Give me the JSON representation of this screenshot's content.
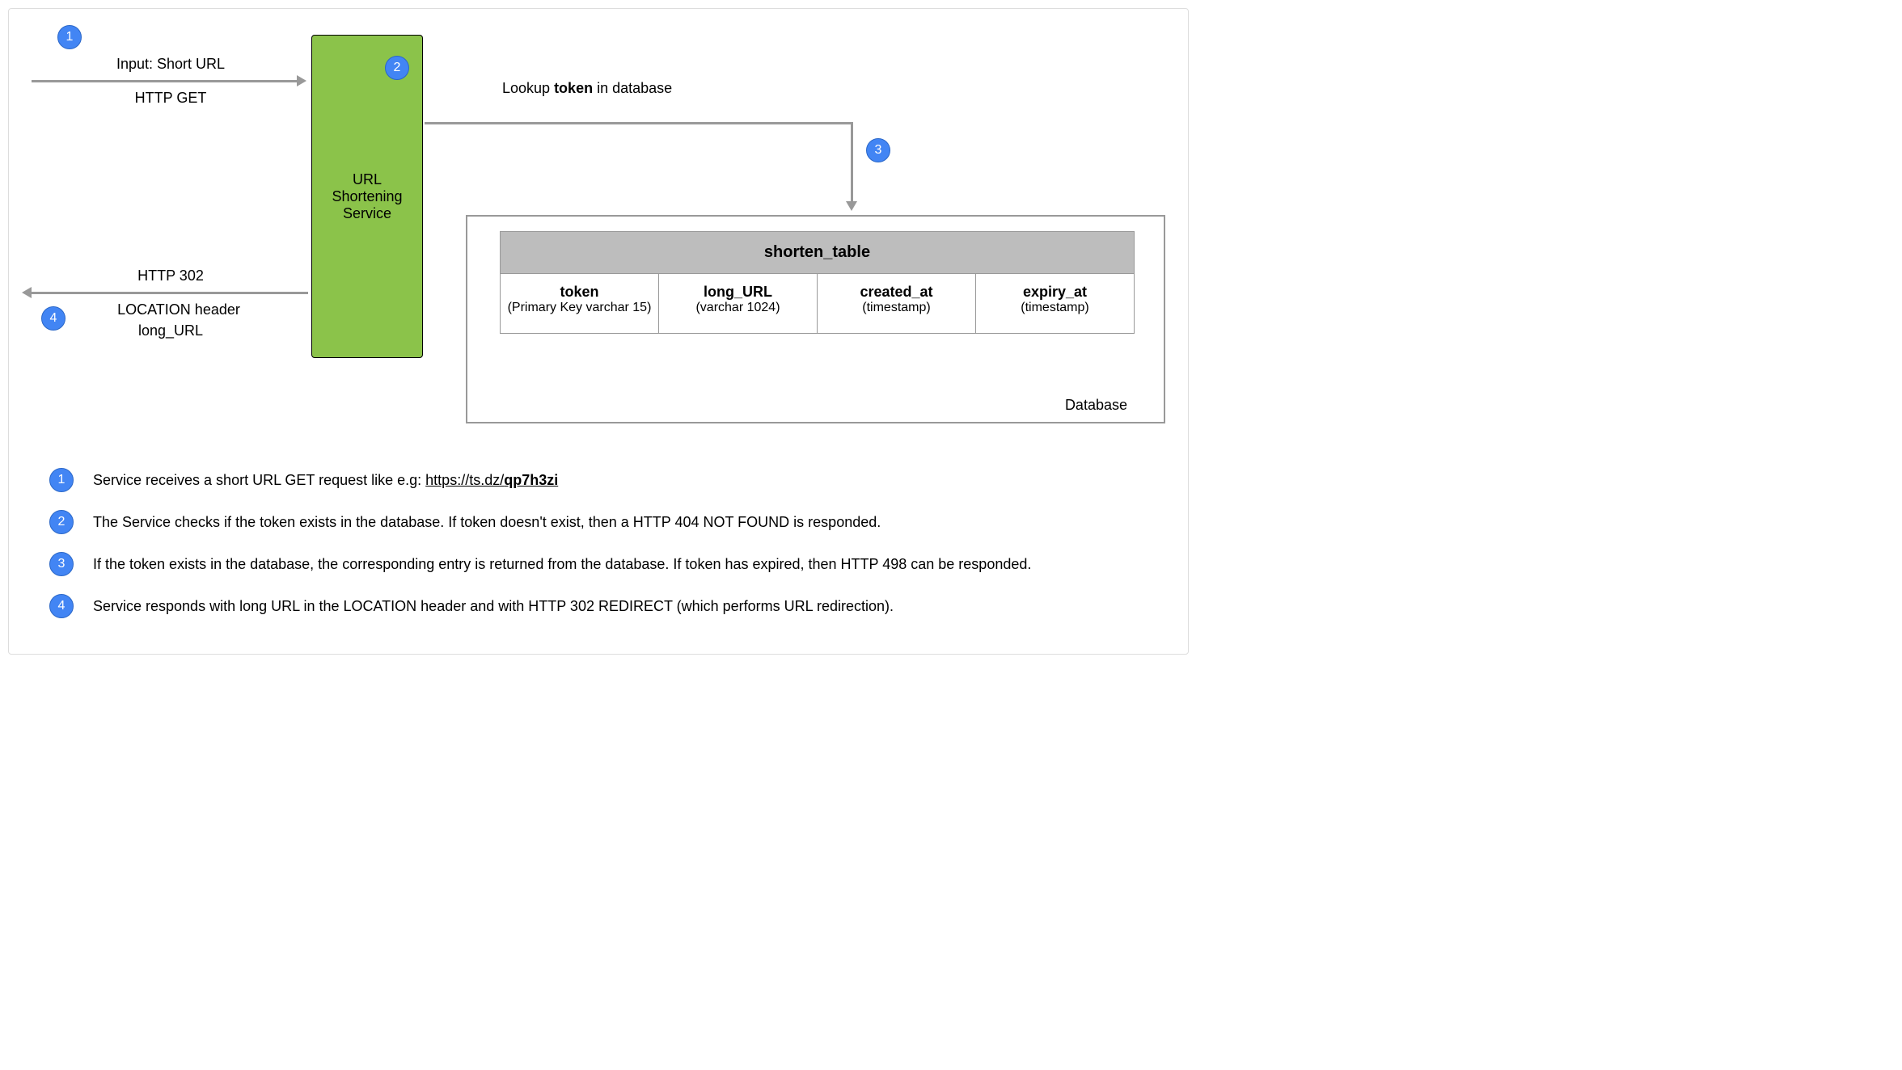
{
  "badges": {
    "b1": "1",
    "b2": "2",
    "b3": "3",
    "b4": "4"
  },
  "arrows": {
    "top_in_label1": "Input: Short URL",
    "top_in_label2": "HTTP GET",
    "lookup_label_prefix": "Lookup ",
    "lookup_label_bold": "token",
    "lookup_label_suffix": " in database",
    "resp_label1": "HTTP 302",
    "resp_label2": "LOCATION header",
    "resp_label3": "long_URL"
  },
  "service_box": "URL Shortening Service",
  "db": {
    "container_label": "Database",
    "table_name": "shorten_table",
    "columns": [
      {
        "name": "token",
        "type": "(Primary Key varchar 15)"
      },
      {
        "name": "long_URL",
        "type": "(varchar 1024)"
      },
      {
        "name": "created_at",
        "type": "(timestamp)"
      },
      {
        "name": "expiry_at",
        "type": "(timestamp)"
      }
    ]
  },
  "steps": {
    "s1_prefix": "Service receives a short URL GET request like e.g: ",
    "s1_link_plain": "https://ts.dz/",
    "s1_link_bold": "qp7h3zi",
    "s2": "The Service checks if the token exists in the database. If token doesn't exist, then a HTTP 404 NOT FOUND is responded.",
    "s3": "If the token exists in the database, the corresponding entry is returned from the database. If token has expired, then HTTP 498 can be responded.",
    "s4": "Service responds with long URL in the LOCATION header and with HTTP 302 REDIRECT (which performs URL redirection)."
  }
}
